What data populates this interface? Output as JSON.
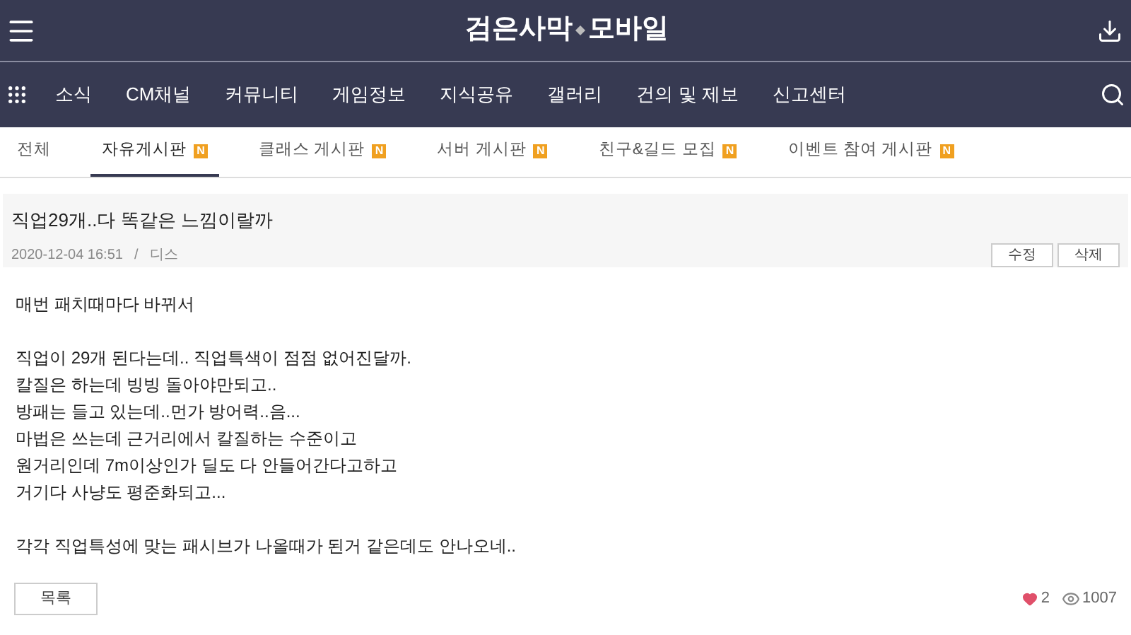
{
  "header": {
    "title_left": "검은사막",
    "title_right": "모바일"
  },
  "nav": {
    "items": [
      "소식",
      "CM채널",
      "커뮤니티",
      "게임정보",
      "지식공유",
      "갤러리",
      "건의 및 제보",
      "신고센터"
    ]
  },
  "tabs": [
    {
      "label": "전체",
      "selected": false
    },
    {
      "label": "자유게시판",
      "selected": true,
      "badge": "N"
    },
    {
      "label": "클래스 게시판",
      "selected": false,
      "badge": "N"
    },
    {
      "label": "서버 게시판",
      "selected": false,
      "badge": "N"
    },
    {
      "label": "친구&길드 모집",
      "selected": false,
      "badge": "N"
    },
    {
      "label": "이벤트 참여 게시판",
      "selected": false,
      "badge": "N"
    }
  ],
  "post": {
    "title": "직업29개..다 똑같은 느낌이랄까",
    "date": "2020-12-04 16:51",
    "separator": "/",
    "author": "디스",
    "buttons": [
      "수정",
      "삭제"
    ],
    "paragraphs": [
      [
        "매번 패치때마다 바뀌서"
      ],
      [
        "직업이 29개 된다는데.. 직업특색이 점점 없어진달까.",
        "칼질은 하는데 빙빙 돌아야만되고..",
        "방패는 들고 있는데..먼가 방어력..음...",
        "마법은 쓰는데 근거리에서 칼질하는 수준이고",
        "원거리인데 7m이상인가 딜도 다 안들어간다고하고",
        "거기다 사냥도 평준화되고..."
      ],
      [
        "각각 직업특성에 맞는 패시브가 나올때가 된거 같은데도 안나오네.."
      ]
    ],
    "list_button": "목록",
    "likes": "2",
    "views": "1007"
  }
}
